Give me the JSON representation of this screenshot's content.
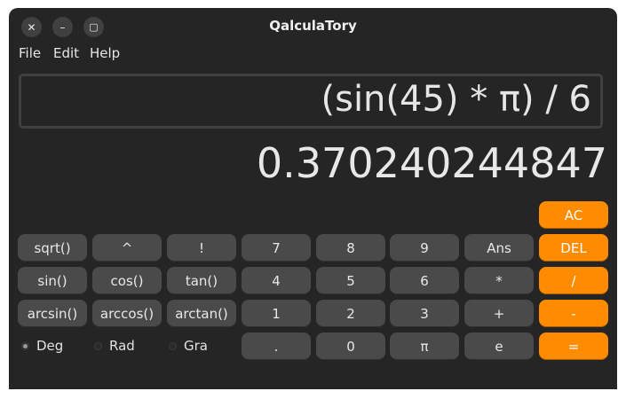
{
  "window": {
    "title": "QalculaTory",
    "controls": {
      "close": "✕",
      "minimize": "–",
      "maximize": "▢"
    }
  },
  "menu": {
    "file": "File",
    "edit": "Edit",
    "help": "Help"
  },
  "display": {
    "expression": "(sin(45) * π) / 6",
    "result": "0.370240244847"
  },
  "keys": {
    "ac": "AC",
    "del": "DEL",
    "sqrt": "sqrt()",
    "pow": "^",
    "fact": "!",
    "n7": "7",
    "n8": "8",
    "n9": "9",
    "ans": "Ans",
    "sin": "sin()",
    "cos": "cos()",
    "tan": "tan()",
    "n4": "4",
    "n5": "5",
    "n6": "6",
    "mul": "*",
    "div": "/",
    "asin": "arcsin()",
    "acos": "arccos()",
    "atan": "arctan()",
    "n1": "1",
    "n2": "2",
    "n3": "3",
    "add": "+",
    "sub": "-",
    "dot": ".",
    "n0": "0",
    "pi": "π",
    "e": "e",
    "eq": "="
  },
  "angle_mode": {
    "deg": "Deg",
    "rad": "Rad",
    "gra": "Gra",
    "selected": "Deg"
  },
  "colors": {
    "accent": "#ff8c00",
    "background": "#252525",
    "key": "#4a4a4a"
  }
}
